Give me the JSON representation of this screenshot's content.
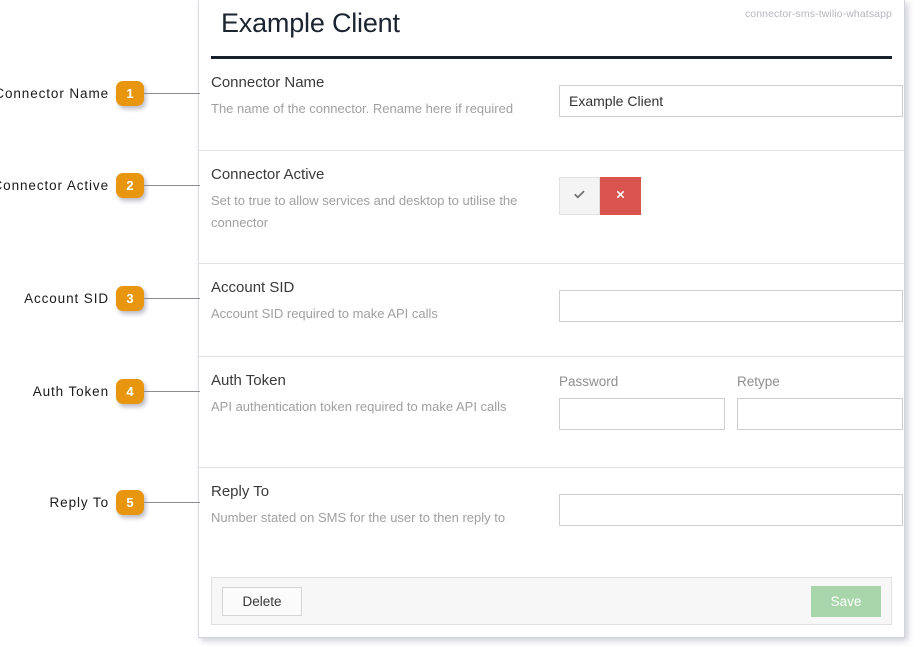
{
  "header": {
    "title": "Example Client",
    "connector_id": "connector-sms-twilio-whatsapp"
  },
  "annotations": [
    {
      "number": "1",
      "label": "Connector Name"
    },
    {
      "number": "2",
      "label": "Connector Active"
    },
    {
      "number": "3",
      "label": "Account SID"
    },
    {
      "number": "4",
      "label": "Auth Token"
    },
    {
      "number": "5",
      "label": "Reply To"
    }
  ],
  "form": {
    "rows": [
      {
        "label": "Connector Name",
        "description": "The name of the connector. Rename here if required",
        "value": "Example Client",
        "placeholder": ""
      },
      {
        "label": "Connector Active",
        "description": "Set to true to allow services and desktop to utilise the connector",
        "toggle": {
          "yes_icon": "check-icon",
          "no_icon": "cross-icon",
          "selected": "no"
        }
      },
      {
        "label": "Account SID",
        "description": "Account SID required to make API calls",
        "value": "",
        "placeholder": ""
      },
      {
        "label": "Auth Token",
        "description": "API authentication token required to make API calls",
        "password_caption": "Password",
        "retype_caption": "Retype",
        "password_value": "",
        "retype_value": ""
      },
      {
        "label": "Reply To",
        "description": "Number stated on SMS for the user to then reply to",
        "value": "",
        "placeholder": ""
      }
    ],
    "footer": {
      "delete_label": "Delete",
      "save_label": "Save"
    }
  },
  "colors": {
    "badge_orange": "#e8960f",
    "rule_dark": "#14202c",
    "toggle_no_red": "#d9534f",
    "save_green": "#a9d5ab"
  }
}
